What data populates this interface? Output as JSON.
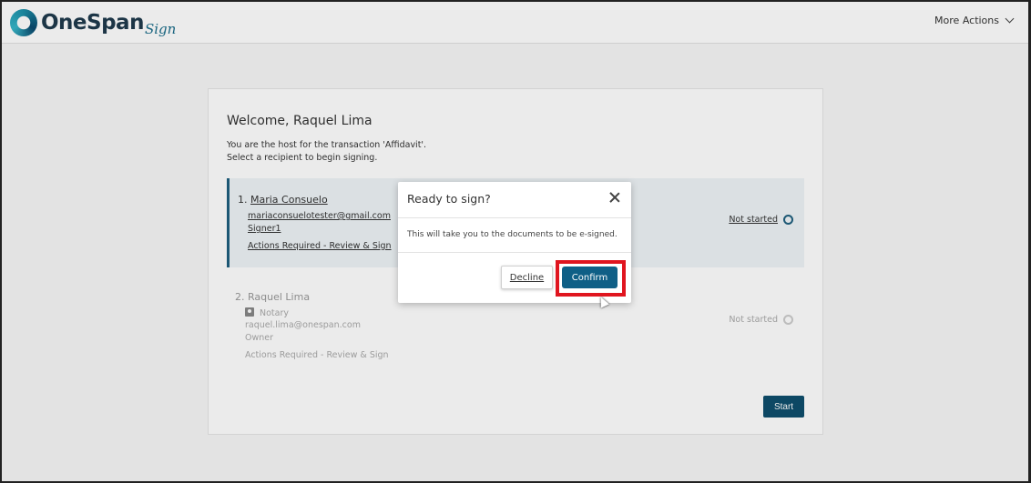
{
  "header": {
    "logo_text": "OneSpan",
    "logo_sub": "Sign",
    "more_actions": "More Actions"
  },
  "welcome": {
    "title": "Welcome, Raquel Lima",
    "line1": "You are the host for the transaction 'Affidavit'.",
    "line2": "Select a recipient to begin signing."
  },
  "recipients": [
    {
      "index": "1.",
      "name": "Maria Consuelo",
      "email": "mariaconsuelotester@gmail.com",
      "role": "Signer1",
      "action": "Actions Required - Review & Sign",
      "status": "Not started"
    },
    {
      "index": "2.",
      "name": "Raquel Lima",
      "badge": "Notary",
      "email": "raquel.lima@onespan.com",
      "role": "Owner",
      "action": "Actions Required - Review & Sign",
      "status": "Not started"
    }
  ],
  "start_label": "Start",
  "modal": {
    "title": "Ready to sign?",
    "body": "This will take you to the documents to be e-signed.",
    "decline": "Decline",
    "confirm": "Confirm"
  },
  "colors": {
    "brand": "#0f5f86",
    "highlight": "#e0151f"
  }
}
